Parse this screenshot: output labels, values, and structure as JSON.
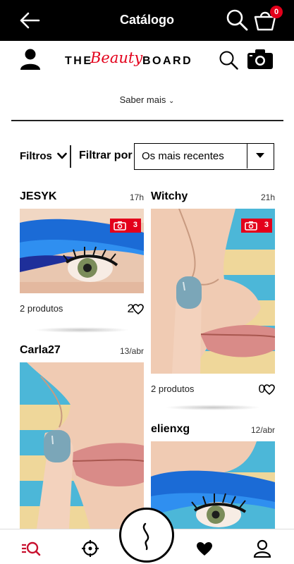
{
  "header": {
    "title": "Catálogo",
    "cart_count": "0",
    "back_icon": "arrow-left-icon",
    "search_icon": "search-icon",
    "cart_icon": "shopping-bag-icon"
  },
  "brand": {
    "logo_left": "THE",
    "logo_script": "Beauty",
    "logo_right": "BOARD",
    "profile_icon": "user-icon",
    "search_icon": "search-icon",
    "camera_icon": "camera-icon"
  },
  "saber_mais": "Saber mais",
  "filters": {
    "filters_label": "Filtros",
    "filter_by_label": "Filtrar por",
    "sort_value": "Os mais recentes"
  },
  "cards": [
    {
      "user": "JESYK",
      "time": "17h",
      "photos": "3",
      "products": "2 produtos",
      "likes": "2"
    },
    {
      "user": "Witchy",
      "time": "21h",
      "photos": "3",
      "products": "2 produtos",
      "likes": "0"
    },
    {
      "user": "Carla27",
      "time": "13/abr"
    },
    {
      "user": "elienxg",
      "time": "12/abr"
    }
  ],
  "bottom_nav": {
    "items": [
      "catalog-search-icon",
      "target-icon",
      "sephora-s-icon",
      "heart-icon",
      "user-icon"
    ]
  },
  "colors": {
    "accent": "#e3001b",
    "appbar": "#000000"
  }
}
